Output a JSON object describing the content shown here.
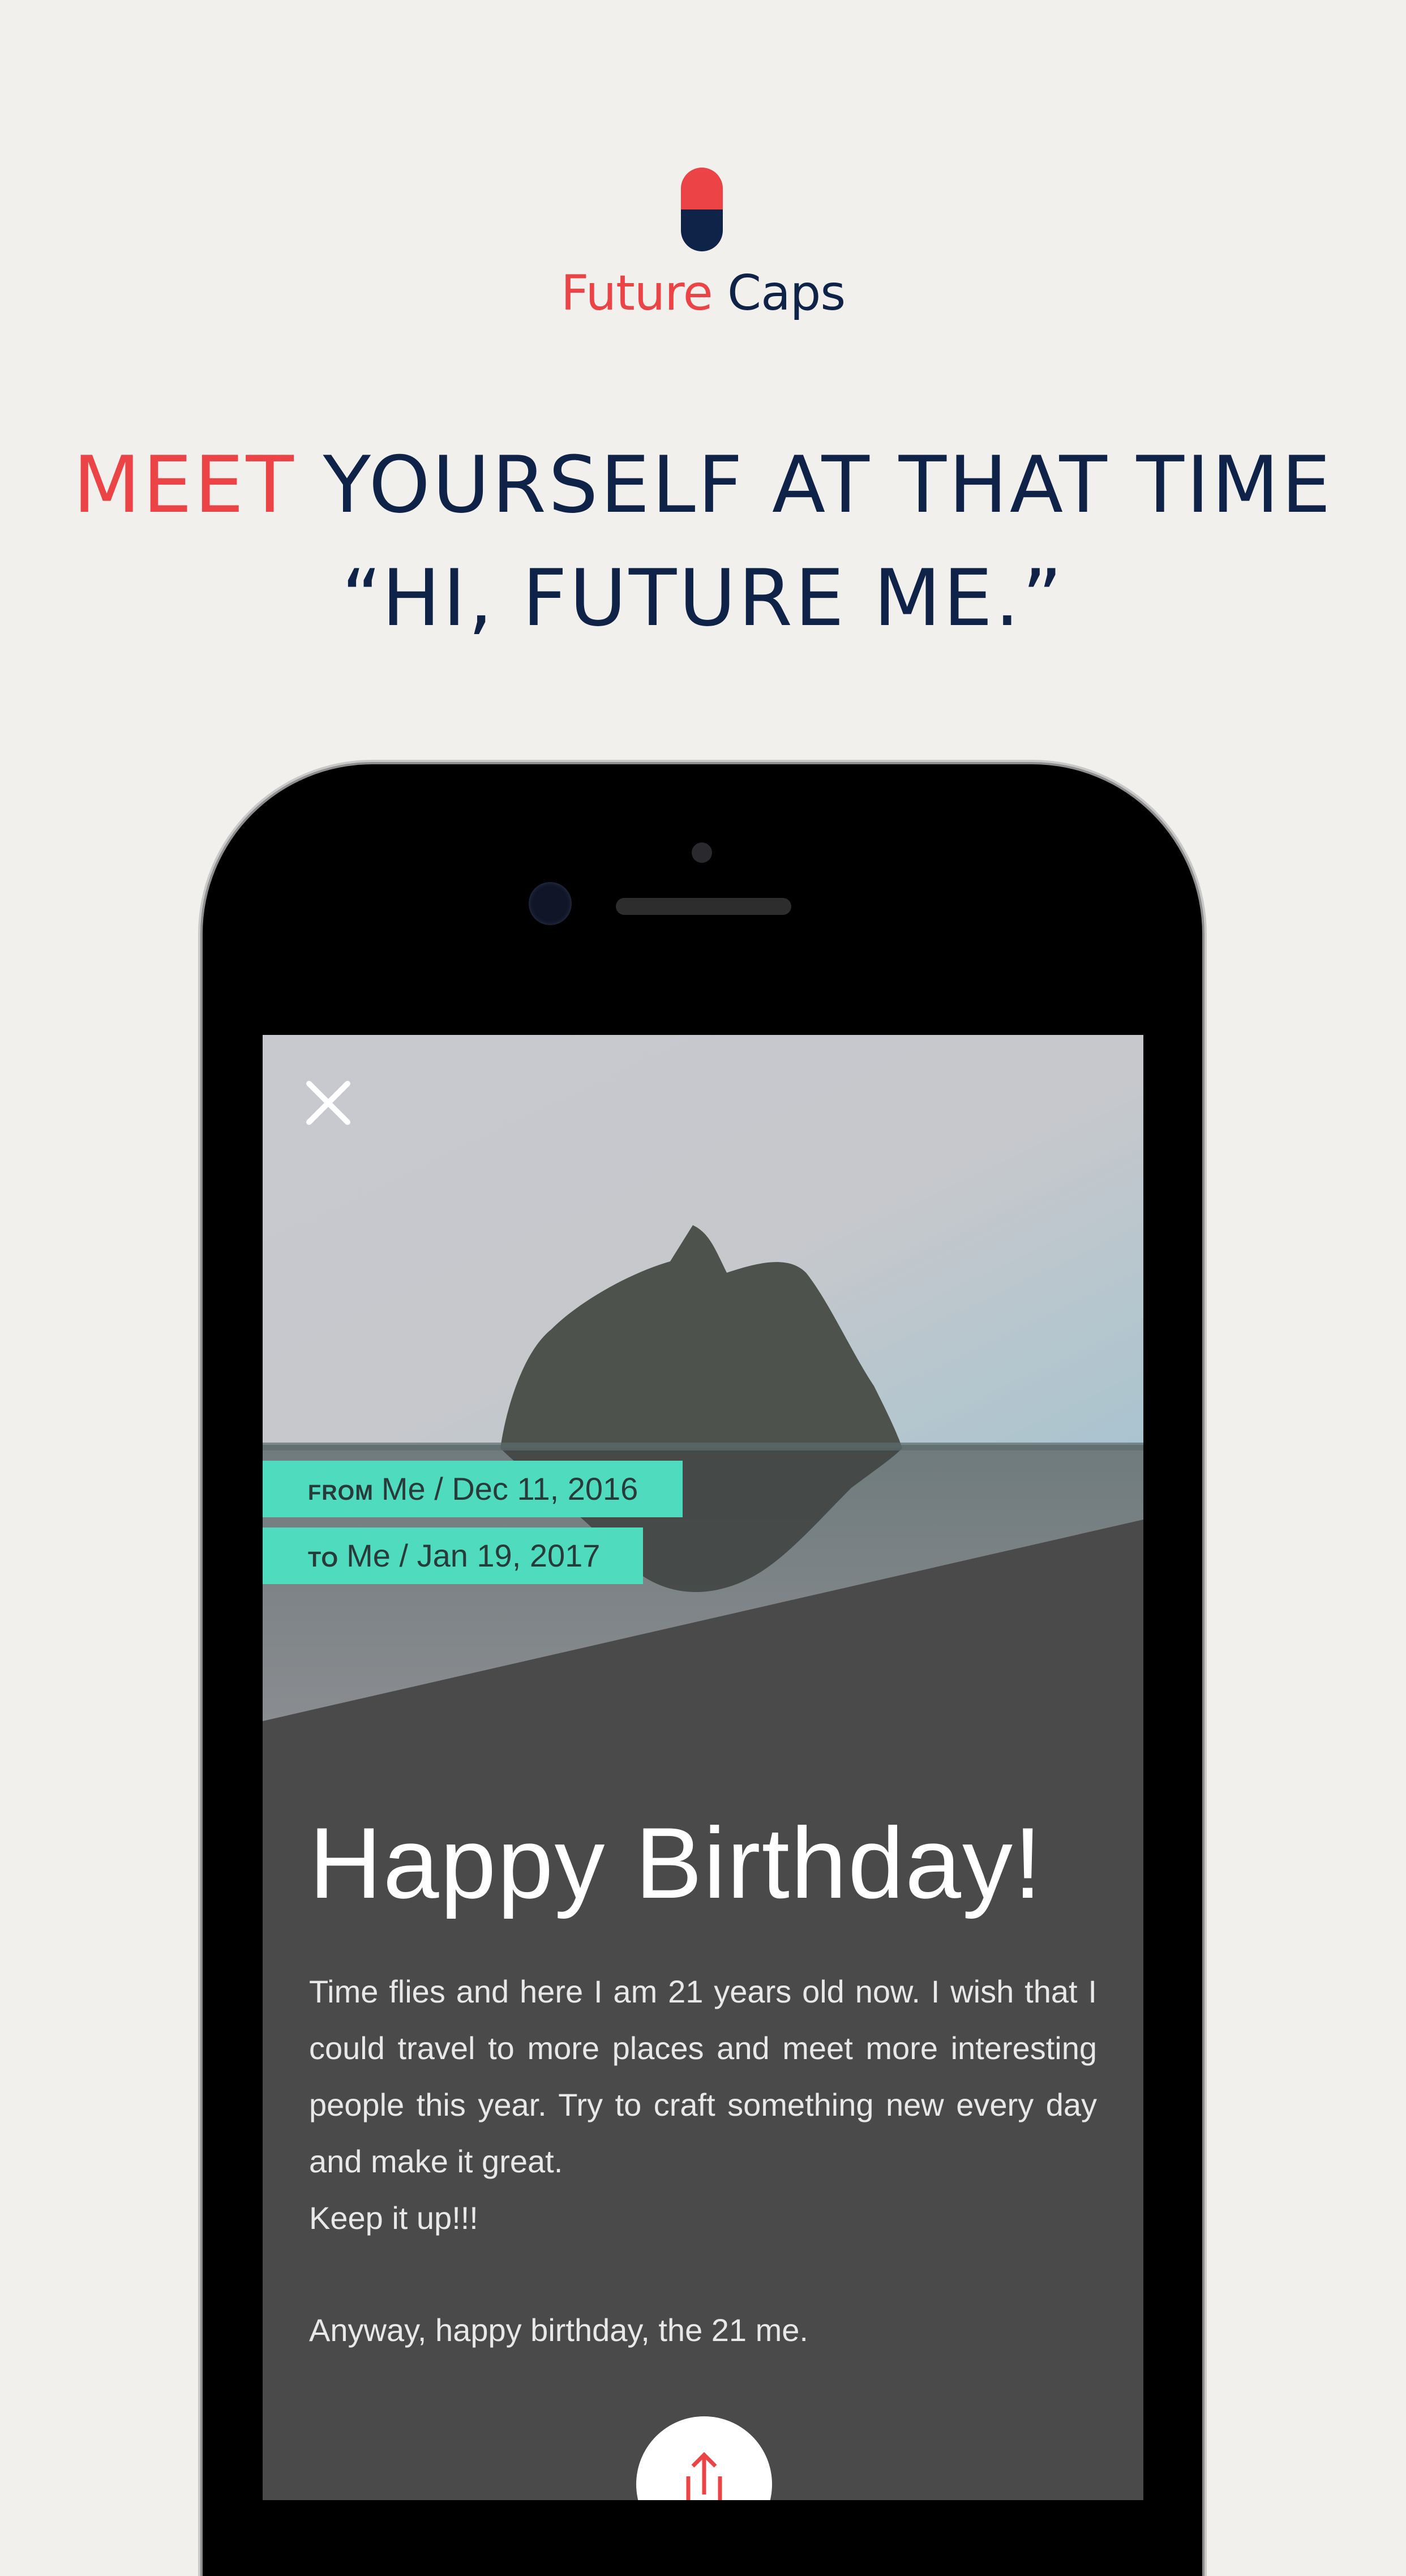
{
  "brand": {
    "name_part1": "Future",
    "name_part2": "Caps",
    "colors": {
      "red": "#eb4346",
      "navy": "#0f2348"
    }
  },
  "headline": {
    "line1_accent": "MEET",
    "line1_rest": "YOURSELF AT THAT TIME",
    "line2": "“HI, FUTURE ME.”"
  },
  "letter": {
    "close_icon": "close-icon",
    "from": {
      "label": "FROM",
      "value": "Me / Dec 11, 2016"
    },
    "to": {
      "label": "TO",
      "value": "Me / Jan 19, 2017"
    },
    "title": "Happy Birthday!",
    "paragraphs": [
      "Time flies and here I am 21 years old now. I wish that I could travel to more places and meet more interesting people this year. Try to craft something new every day and make it great.",
      "Keep it up!!!",
      "Anyway, happy birthday, the 21 me."
    ],
    "share_icon": "share-icon",
    "tag_color": "#4fdcbe"
  }
}
